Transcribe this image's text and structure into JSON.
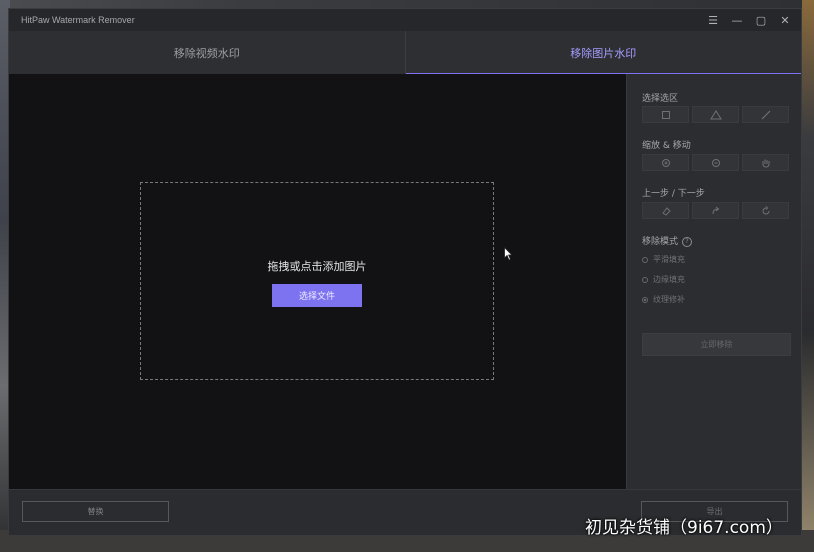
{
  "window": {
    "title": "HitPaw Watermark Remover",
    "controls": [
      "☰",
      "—",
      "▢",
      "✕"
    ]
  },
  "tabs": [
    {
      "label": "移除视频水印",
      "active": false
    },
    {
      "label": "移除图片水印",
      "active": true
    }
  ],
  "dropzone": {
    "prompt": "拖拽或点击添加图片",
    "button_label": "选择文件"
  },
  "panel": {
    "select_area_label": "选择选区",
    "zoom_move_label": "缩放 & 移动",
    "undo_redo_label": "上一步 / 下一步",
    "remove_mode_label": "移除模式",
    "modes": [
      {
        "label": "平滑填充",
        "checked": false
      },
      {
        "label": "边缘填充",
        "checked": false
      },
      {
        "label": "纹理修补",
        "checked": true
      }
    ],
    "remove_now_label": "立即移除"
  },
  "bottom": {
    "replace_label": "替换",
    "export_label": "导出"
  },
  "overlay": {
    "site_watermark": "初见杂货铺（9i67.com）"
  },
  "colors": {
    "accent": "#7d72f0"
  }
}
